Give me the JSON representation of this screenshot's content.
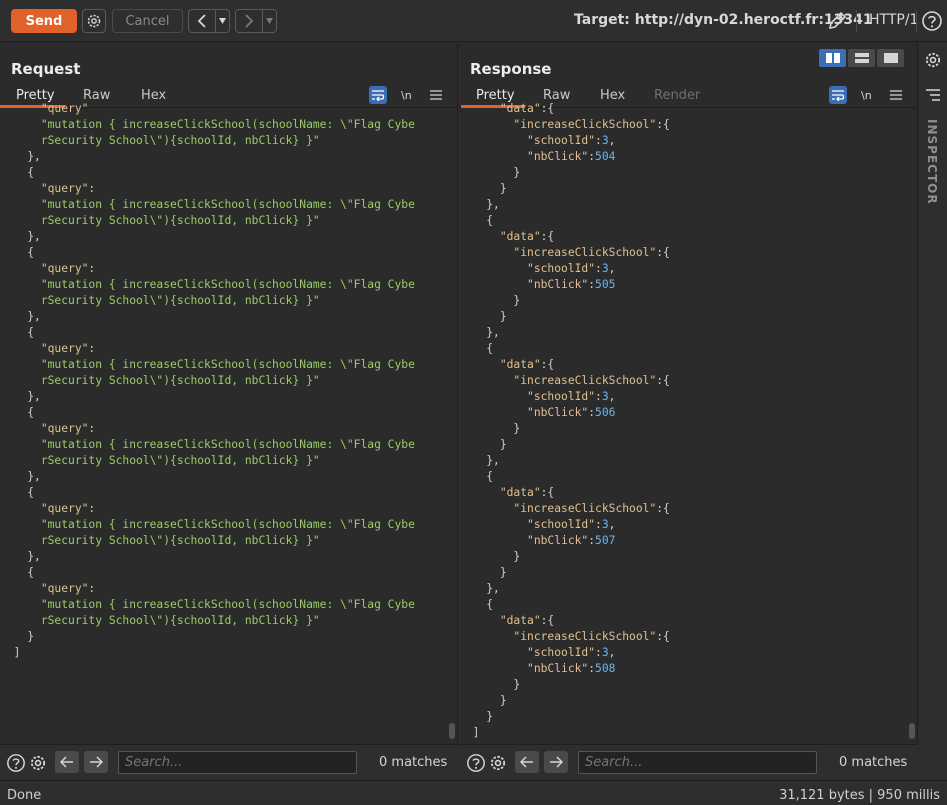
{
  "toolbar": {
    "send_label": "Send",
    "cancel_label": "Cancel",
    "target_text": "Target: http://dyn-02.heroctf.fr:13341",
    "protocol": "HTTP/1"
  },
  "request": {
    "title": "Request",
    "tabs": [
      "Pretty",
      "Raw",
      "Hex"
    ],
    "active_tab": "Pretty",
    "search_placeholder": "Search...",
    "matches": "0 matches",
    "query_key": "\"query\"",
    "mutation_line1": "\"mutation { increaseClickSchool(schoolName: \\\"Flag Cybe",
    "mutation_line2": "rSecurity School\\\"){schoolId, nbClick} }\"",
    "top_partial": "\"query\"",
    "closing_bracket": "]"
  },
  "response": {
    "title": "Response",
    "tabs": [
      "Pretty",
      "Raw",
      "Hex",
      "Render"
    ],
    "active_tab": "Pretty",
    "search_placeholder": "Search...",
    "matches": "0 matches",
    "data_key": "\"data\"",
    "field_key": "\"increaseClickSchool\"",
    "school_key": "\"schoolId\"",
    "school_id": "3",
    "click_key": "\"nbClick\"",
    "click_values": [
      "504",
      "505",
      "506",
      "507",
      "508"
    ],
    "closing_bracket": "]"
  },
  "inspector": {
    "label": "INSPECTOR"
  },
  "status": {
    "left": "Done",
    "right": "31,121 bytes | 950 millis"
  },
  "colors": {
    "accent": "#e0612a",
    "active_blue": "#3a6fb5",
    "json_key": "#e2c08d",
    "json_string": "#9ccc65",
    "json_number": "#68b6e8"
  }
}
